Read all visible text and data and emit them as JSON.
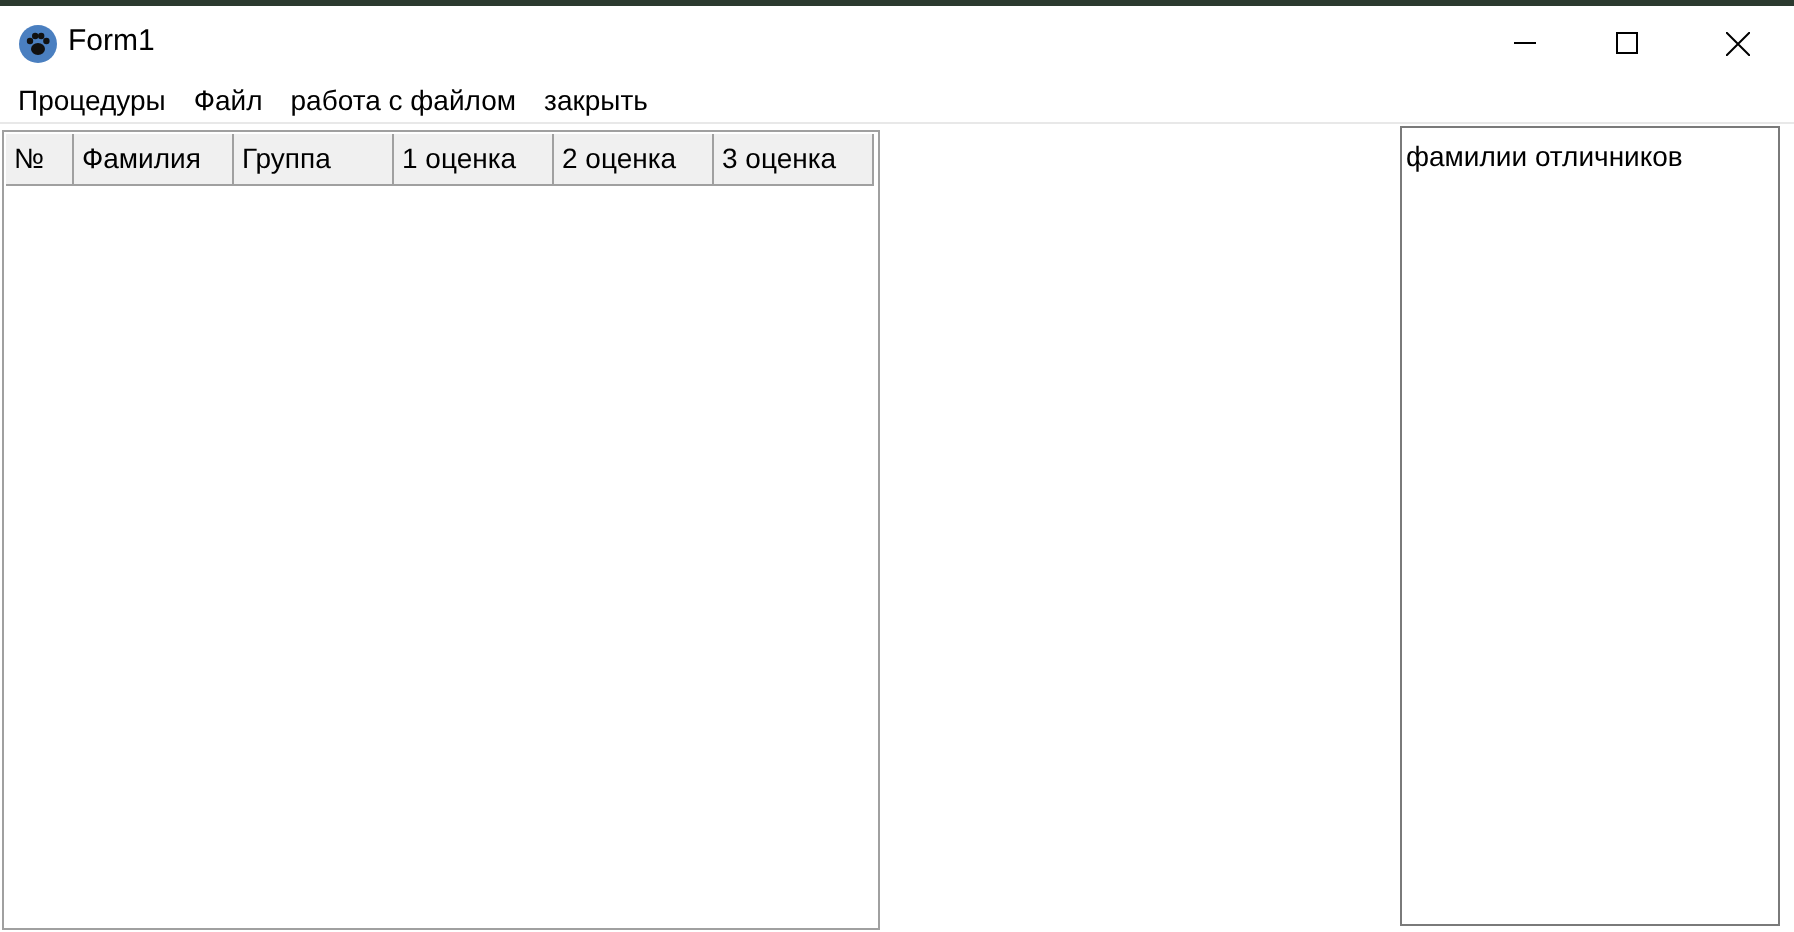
{
  "window": {
    "title": "Form1"
  },
  "menu": [
    "Процедуры",
    "Файл",
    "работа с файлом",
    "закрыть"
  ],
  "table": {
    "columns": [
      "№",
      "Фамилия",
      "Группа",
      "1 оценка",
      "2 оценка",
      "3 оценка"
    ]
  },
  "text_box": {
    "value": "фамилии отличников"
  }
}
